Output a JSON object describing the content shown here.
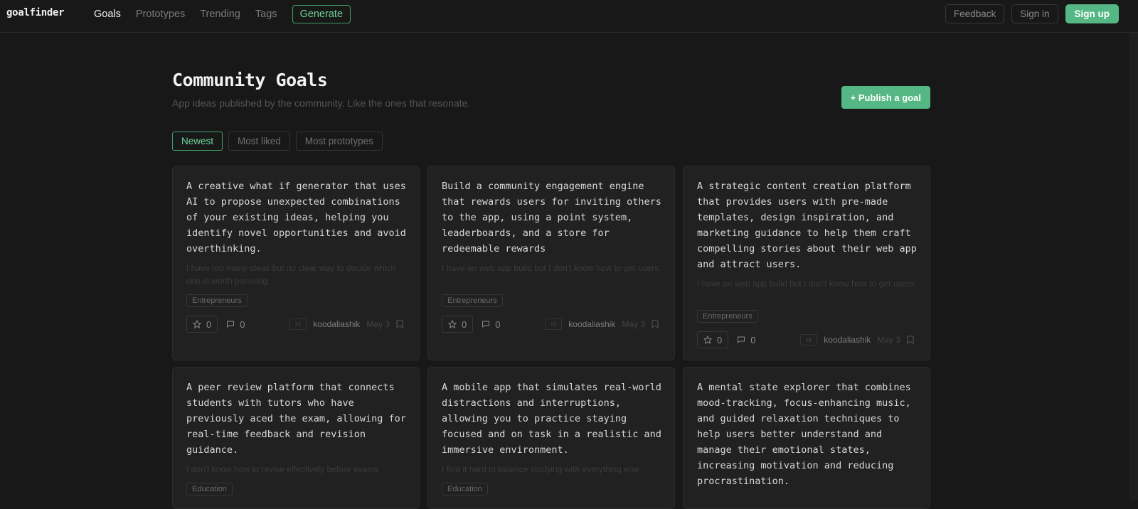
{
  "app": {
    "logo": "goalfinder"
  },
  "nav": {
    "items": [
      "Goals",
      "Prototypes",
      "Trending",
      "Tags"
    ],
    "generate_label": "Generate"
  },
  "header_actions": {
    "feedback": "Feedback",
    "sign_in": "Sign in",
    "sign_up": "Sign up"
  },
  "page": {
    "title": "Community Goals",
    "subtitle": "App ideas published by the community. Like the ones that resonate.",
    "publish_label": "+ Publish a goal"
  },
  "filters": [
    "Newest",
    "Most liked",
    "Most prototypes"
  ],
  "cards": [
    {
      "goal": "A creative what if generator that uses AI to propose unexpected combinations of your existing ideas, helping you identify novel opportunities and avoid overthinking.",
      "problem": "I have too many ideas but no clear way to decide which one is worth pursuing.",
      "tag": "Entrepreneurs",
      "stars": "0",
      "comments": "0",
      "avatar": "#1",
      "author": "koodaliashik",
      "date": "May 3"
    },
    {
      "goal": "Build a community engagement engine that rewards users for inviting others to the app, using a point system, leaderboards, and a store for redeemable rewards",
      "problem": "I have an web app build but I don't know how to get users.",
      "tag": "Entrepreneurs",
      "stars": "0",
      "comments": "0",
      "avatar": "#1",
      "author": "koodaliashik",
      "date": "May 3"
    },
    {
      "goal": "A strategic content creation platform that provides users with pre-made templates, design inspiration, and marketing guidance to help them craft compelling stories about their web app and attract users.",
      "problem": "I have an web app build but I don't know how to get users.",
      "tag": "Entrepreneurs",
      "stars": "0",
      "comments": "0",
      "avatar": "#1",
      "author": "koodaliashik",
      "date": "May 3"
    },
    {
      "goal": "A peer review platform that connects students with tutors who have previously aced the exam, allowing for real-time feedback and revision guidance.",
      "problem": "I don't know how to revise effectively before exams",
      "tag": "Education"
    },
    {
      "goal": "A mobile app that simulates real-world distractions and interruptions, allowing you to practice staying focused and on task in a realistic and immersive environment.",
      "problem": "I find it hard to balance studying with everything else",
      "tag": "Education"
    },
    {
      "goal": "A mental state explorer that combines mood-tracking, focus-enhancing music, and guided relaxation techniques to help users better understand and manage their emotional states, increasing motivation and reducing procrastination."
    }
  ]
}
